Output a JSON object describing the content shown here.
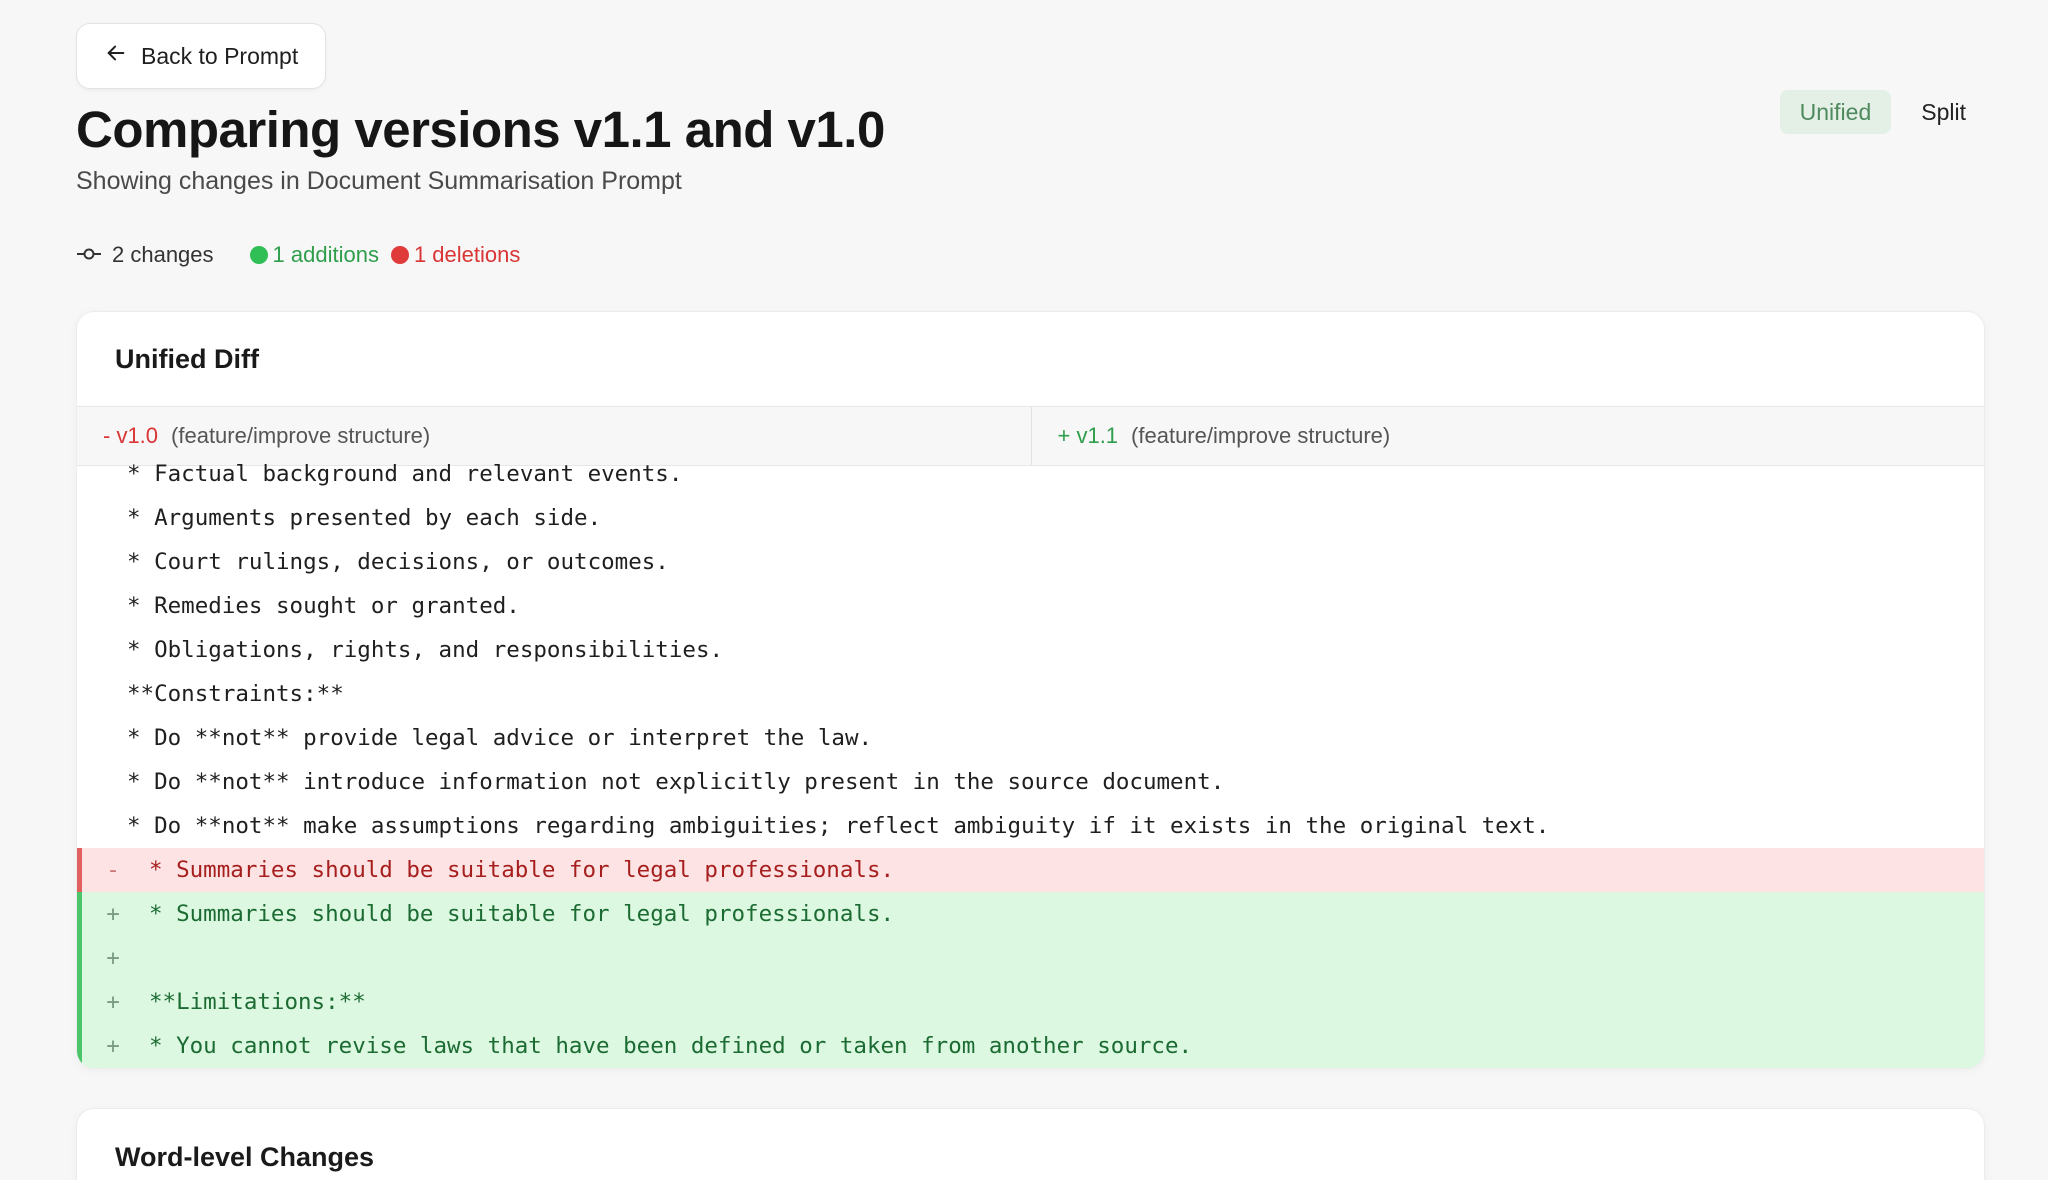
{
  "nav": {
    "back_label": "Back to Prompt"
  },
  "header": {
    "title": "Comparing versions v1.1 and v1.0",
    "subtitle": "Showing changes in Document Summarisation Prompt"
  },
  "view_toggle": {
    "unified_label": "Unified",
    "split_label": "Split",
    "active": "Unified"
  },
  "stats": {
    "changes_label": "2 changes",
    "additions_label": "1 additions",
    "deletions_label": "1 deletions",
    "additions_color": "#2e9e4b",
    "deletions_color": "#d93535"
  },
  "unified_diff": {
    "title": "Unified Diff",
    "old_version": "- v1.0",
    "old_branch": "(feature/improve structure)",
    "new_version": "+ v1.1",
    "new_branch": "(feature/improve structure)",
    "lines": [
      {
        "type": "ctx",
        "marker": "",
        "text": "* Factual background and relevant events."
      },
      {
        "type": "ctx",
        "marker": "",
        "text": "* Arguments presented by each side."
      },
      {
        "type": "ctx",
        "marker": "",
        "text": "* Court rulings, decisions, or outcomes."
      },
      {
        "type": "ctx",
        "marker": "",
        "text": "* Remedies sought or granted."
      },
      {
        "type": "ctx",
        "marker": "",
        "text": "* Obligations, rights, and responsibilities."
      },
      {
        "type": "ctx",
        "marker": "",
        "text": "**Constraints:**"
      },
      {
        "type": "ctx",
        "marker": "",
        "text": "* Do **not** provide legal advice or interpret the law."
      },
      {
        "type": "ctx",
        "marker": "",
        "text": "* Do **not** introduce information not explicitly present in the source document."
      },
      {
        "type": "ctx",
        "marker": "",
        "text": "* Do **not** make assumptions regarding ambiguities; reflect ambiguity if it exists in the original text."
      },
      {
        "type": "del",
        "marker": "-",
        "text": "* Summaries should be suitable for legal professionals."
      },
      {
        "type": "add",
        "marker": "+",
        "text": "* Summaries should be suitable for legal professionals."
      },
      {
        "type": "add",
        "marker": "+",
        "text": ""
      },
      {
        "type": "add",
        "marker": "+",
        "text": "**Limitations:**"
      },
      {
        "type": "add",
        "marker": "+",
        "text": "* You cannot revise laws that have been defined or taken from another source."
      }
    ]
  },
  "word_changes": {
    "title": "Word-level Changes"
  }
}
